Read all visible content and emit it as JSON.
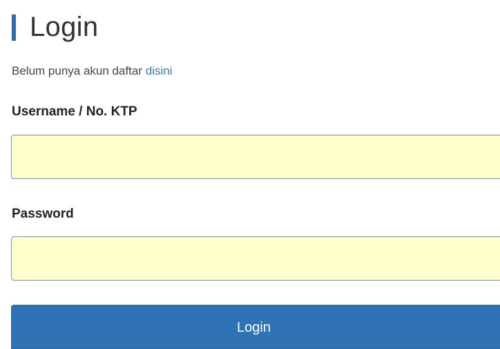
{
  "page": {
    "title": "Login",
    "accent_color": "#2f6ea8"
  },
  "signup": {
    "prefix": "Belum punya akun daftar",
    "link_label": "disini",
    "link_color": "#3d7ab8"
  },
  "form": {
    "username_label": "Username / No. KTP",
    "username_value": "",
    "password_label": "Password",
    "password_value": "",
    "input_background": "#ffffcc",
    "submit_label": "Login",
    "submit_color": "#2f73b5"
  }
}
